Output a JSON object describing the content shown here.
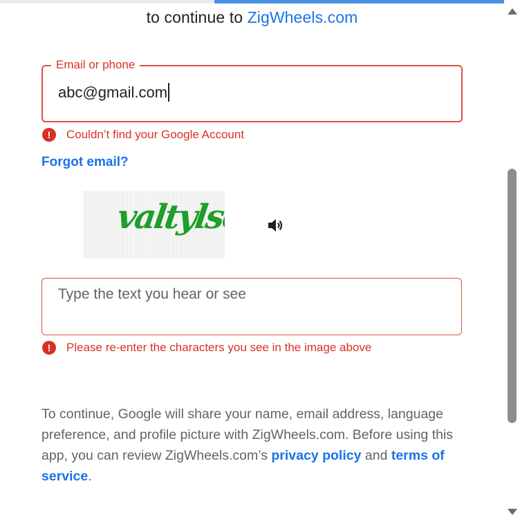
{
  "header": {
    "subtitle_prefix": "to continue to",
    "app_name": "ZigWheels.com"
  },
  "email": {
    "label": "Email or phone",
    "value": "abc@gmail.com",
    "error": "Couldn’t find your Google Account"
  },
  "forgot_email": "Forgot email?",
  "captcha": {
    "image_text": "valtylso",
    "audio_icon": "speaker-icon",
    "placeholder": "Type the text you hear or see",
    "error": "Please re-enter the characters you see in the image above"
  },
  "consent": {
    "line1": "To continue, Google will share your name, email address, language preference, and profile picture with ZigWheels.com. Before using this app, you can review ZigWheels.com’s",
    "privacy_policy": "privacy policy",
    "and": "and",
    "terms_of_service": "terms of service",
    "period": "."
  },
  "icons": {
    "error": "error-icon",
    "error_glyph": "!"
  },
  "colors": {
    "accent": "#1a73e8",
    "error": "#d93025",
    "captcha_text": "#1e9e2b"
  }
}
